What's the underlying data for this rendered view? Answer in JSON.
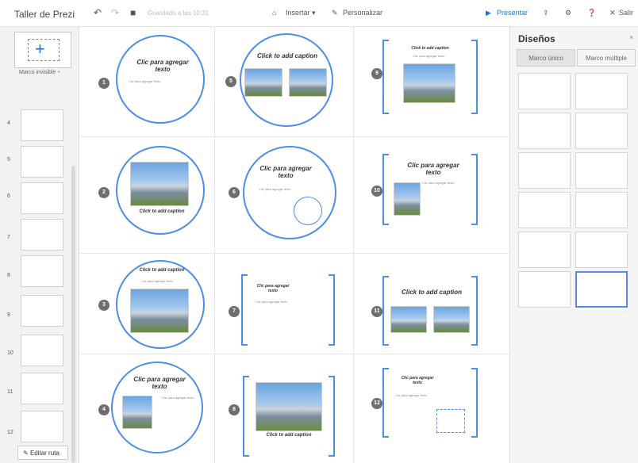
{
  "header": {
    "app_title": "Taller de Prezi",
    "saved_status": "Guardado a las 10:31",
    "insert_label": "Insertar ▾",
    "customize_label": "Personalizar",
    "present_label": "Presentar",
    "exit_label": "Salir"
  },
  "sidebar": {
    "frame_type": "Marco invisible ÷",
    "edit_path_label": "Editar ruta",
    "thumbs": [
      "4",
      "5",
      "6",
      "7",
      "8",
      "9",
      "10",
      "11",
      "12"
    ]
  },
  "canvas": {
    "nums": [
      "1",
      "2",
      "3",
      "4",
      "5",
      "6",
      "7",
      "8",
      "9",
      "10",
      "11",
      "12"
    ],
    "captions": {
      "c1": "Clic para agregar texto",
      "c1_sub": "Clic para agregar texto",
      "c2": "Click to add caption",
      "c3": "Click to add caption",
      "c3_sub": "Clic para agregar texto",
      "c4": "Clic para agregar texto",
      "c4_sub": "Clic para agregar texto",
      "c5": "Click to add caption",
      "c6": "Clic para agregar texto",
      "c6_sub": "Clic para agregar texto",
      "c7": "Clic para agregar texto",
      "c7_sub": "Clic para agregar texto",
      "c8": "Click to add caption",
      "c9": "Click to add caption",
      "c9_sub": "Clic para agregar texto",
      "c10": "Clic para agregar texto",
      "c10_sub": "Clic para agregar texto",
      "c11": "Click to add caption",
      "c12": "Clic para agregar texto",
      "c12_sub": "Clic para agregar texto"
    }
  },
  "panel": {
    "title": "Diseños",
    "close": "×",
    "tab_single": "Marco único",
    "tab_multiple": "Marco múltiple"
  },
  "colors": {
    "accent": "#4c8ee8",
    "present": "#1f72d8"
  }
}
